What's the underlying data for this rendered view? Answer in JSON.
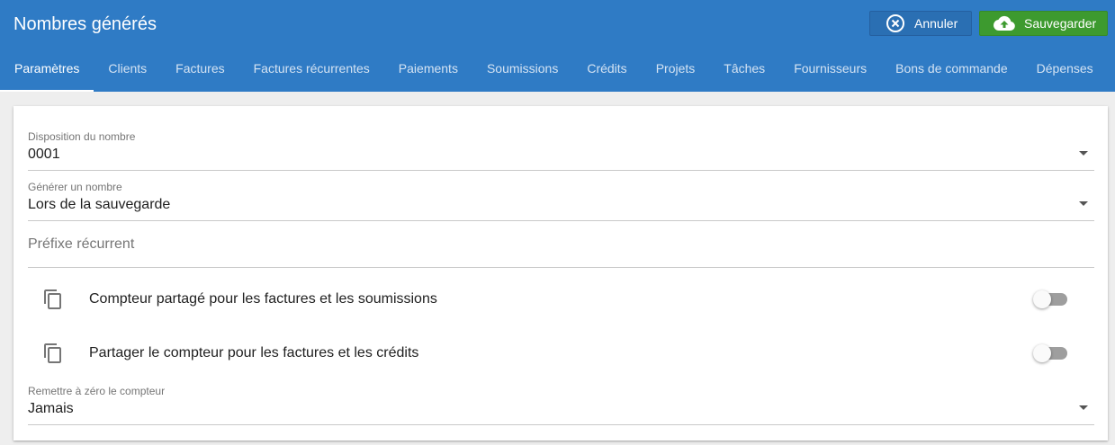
{
  "header": {
    "title": "Nombres générés",
    "cancel_label": "Annuler",
    "save_label": "Sauvegarder"
  },
  "tabs": [
    {
      "label": "Paramètres",
      "active": true
    },
    {
      "label": "Clients"
    },
    {
      "label": "Factures"
    },
    {
      "label": "Factures récurrentes"
    },
    {
      "label": "Paiements"
    },
    {
      "label": "Soumissions"
    },
    {
      "label": "Crédits"
    },
    {
      "label": "Projets"
    },
    {
      "label": "Tâches"
    },
    {
      "label": "Fournisseurs"
    },
    {
      "label": "Bons de commande"
    },
    {
      "label": "Dépenses"
    }
  ],
  "form": {
    "number_pattern": {
      "label": "Disposition du nombre",
      "value": "0001"
    },
    "generate_number": {
      "label": "Générer un nombre",
      "value": "Lors de la sauvegarde"
    },
    "recurring_prefix": {
      "placeholder": "Préfixe récurrent"
    },
    "shared_counter_quotes": {
      "label": "Compteur partagé pour les factures et les soumissions",
      "enabled": false
    },
    "shared_counter_credits": {
      "label": "Partager le compteur pour les factures et les crédits",
      "enabled": false
    },
    "reset_counter": {
      "label": "Remettre à zéro le compteur",
      "value": "Jamais"
    }
  },
  "icons": {
    "cancel": "close-circle-icon",
    "save": "cloud-upload-icon",
    "row": "copy-icon"
  },
  "colors": {
    "appbar": "#2f7bc5",
    "save_button": "#3d9a2f",
    "cancel_button": "#2a6fb3"
  }
}
